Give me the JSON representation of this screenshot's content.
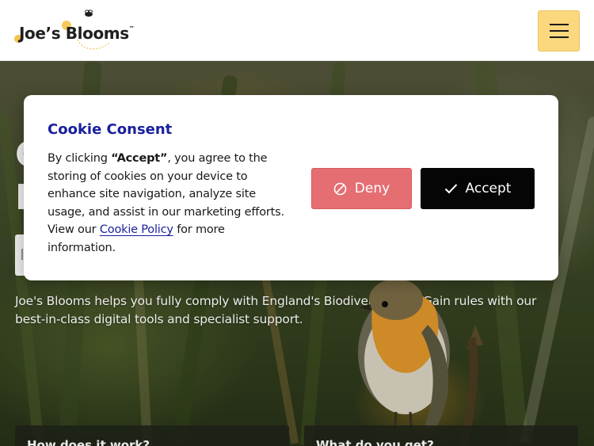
{
  "header": {
    "logo_text": "Joe’s Blooms",
    "logo_tm": "™",
    "menu_label": "Menu"
  },
  "hero": {
    "text": "Joe's Blooms helps you fully comply with England's Biodiversity Net Gain rules with our best-in-class digital tools and specialist support.",
    "cards": [
      {
        "title": "How does it work?"
      },
      {
        "title": "What do you get?"
      }
    ]
  },
  "cookie": {
    "title": "Cookie Consent",
    "text_before": "By clicking ",
    "text_accept_word": "“Accept”",
    "text_middle": ", you agree to the storing of cookies on your device to enhance site navigation, analyze site usage, and assist in our marketing efforts. View our ",
    "link_label": "Cookie Policy",
    "text_after": " for more information.",
    "deny_label": "Deny",
    "accept_label": "Accept"
  },
  "colors": {
    "brand_blue": "#1a1f9c",
    "menu_yellow": "#fbd77e",
    "deny_red": "#e46e72",
    "accept_black": "#050505"
  },
  "icons": {
    "deny": "ban-icon",
    "accept": "check-icon",
    "menu": "hamburger-icon"
  }
}
